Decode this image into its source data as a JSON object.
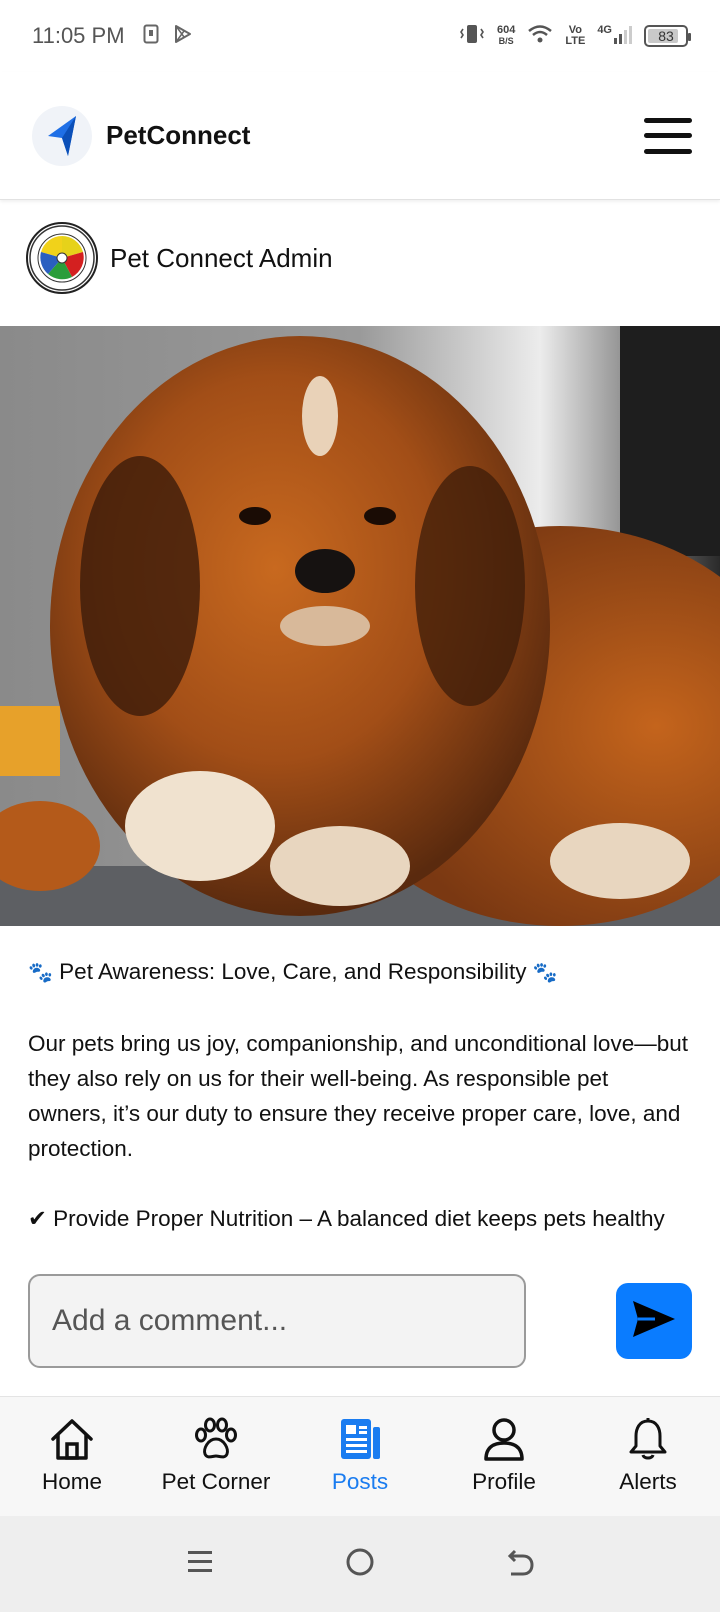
{
  "status_bar": {
    "time": "11:05 PM",
    "net_speed_value": "604",
    "net_speed_unit": "B/S",
    "volte_top": "Vo",
    "volte_bottom": "LTE",
    "network": "4G",
    "battery": "83",
    "battery_level": 0.83
  },
  "header": {
    "app_title": "PetConnect",
    "logo_icon": "paper-plane-icon",
    "menu_icon": "hamburger-menu-icon"
  },
  "post": {
    "author": "Pet Connect Admin",
    "image_subject": "fluffy-puppy-photo",
    "paw_glyph": "🐾",
    "headline": "Pet Awareness: Love, Care, and Responsibility",
    "body": "Our pets bring us joy, companionship, and unconditional love—but they also rely on us for their well-being. As responsible pet owners, it’s our duty to ensure they receive proper care, love, and protection.",
    "check_glyph": "✔",
    "bullet_1": "Provide Proper Nutrition – A balanced diet keeps pets healthy and active."
  },
  "comment": {
    "placeholder": "Add a comment...",
    "send_icon": "send-icon"
  },
  "nav": {
    "items": [
      {
        "label": "Home",
        "icon": "home-icon"
      },
      {
        "label": "Pet Corner",
        "icon": "paw-icon"
      },
      {
        "label": "Posts",
        "icon": "posts-icon",
        "active": true
      },
      {
        "label": "Profile",
        "icon": "profile-icon"
      },
      {
        "label": "Alerts",
        "icon": "bell-icon"
      }
    ]
  },
  "colors": {
    "accent": "#0a7cff",
    "active_nav": "#1a7cf0"
  }
}
